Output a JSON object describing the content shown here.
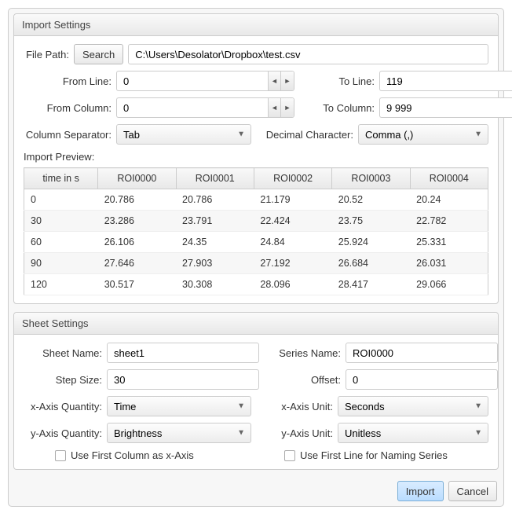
{
  "importSettings": {
    "title": "Import Settings",
    "filePathLabel": "File Path:",
    "searchBtn": "Search",
    "filePathValue": "C:\\Users\\Desolator\\Dropbox\\test.csv",
    "fromLineLabel": "From Line:",
    "fromLineValue": "0",
    "toLineLabel": "To Line:",
    "toLineValue": "119",
    "fromColumnLabel": "From Column:",
    "fromColumnValue": "0",
    "toColumnLabel": "To Column:",
    "toColumnValue": "9 999",
    "columnSeparatorLabel": "Column Separator:",
    "columnSeparatorValue": "Tab",
    "decimalCharLabel": "Decimal Character:",
    "decimalCharValue": "Comma (,)",
    "previewLabel": "Import Preview:",
    "preview": {
      "headers": [
        "time in s",
        "ROI0000",
        "ROI0001",
        "ROI0002",
        "ROI0003",
        "ROI0004"
      ],
      "rows": [
        [
          "0",
          "20.786",
          "20.786",
          "21.179",
          "20.52",
          "20.24"
        ],
        [
          "30",
          "23.286",
          "23.791",
          "22.424",
          "23.75",
          "22.782"
        ],
        [
          "60",
          "26.106",
          "24.35",
          "24.84",
          "25.924",
          "25.331"
        ],
        [
          "90",
          "27.646",
          "27.903",
          "27.192",
          "26.684",
          "26.031"
        ],
        [
          "120",
          "30.517",
          "30.308",
          "28.096",
          "28.417",
          "29.066"
        ]
      ]
    }
  },
  "sheetSettings": {
    "title": "Sheet Settings",
    "sheetNameLabel": "Sheet Name:",
    "sheetNameValue": "sheet1",
    "seriesNameLabel": "Series Name:",
    "seriesNameValue": "ROI0000",
    "stepSizeLabel": "Step Size:",
    "stepSizeValue": "30",
    "offsetLabel": "Offset:",
    "offsetValue": "0",
    "xQuantityLabel": "x-Axis Quantity:",
    "xQuantityValue": "Time",
    "xUnitLabel": "x-Axis Unit:",
    "xUnitValue": "Seconds",
    "yQuantityLabel": "y-Axis Quantity:",
    "yQuantityValue": "Brightness",
    "yUnitLabel": "y-Axis Unit:",
    "yUnitValue": "Unitless",
    "useFirstColLabel": "Use First Column as x-Axis",
    "useFirstLineLabel": "Use First Line for Naming Series"
  },
  "footer": {
    "importBtn": "Import",
    "cancelBtn": "Cancel"
  }
}
